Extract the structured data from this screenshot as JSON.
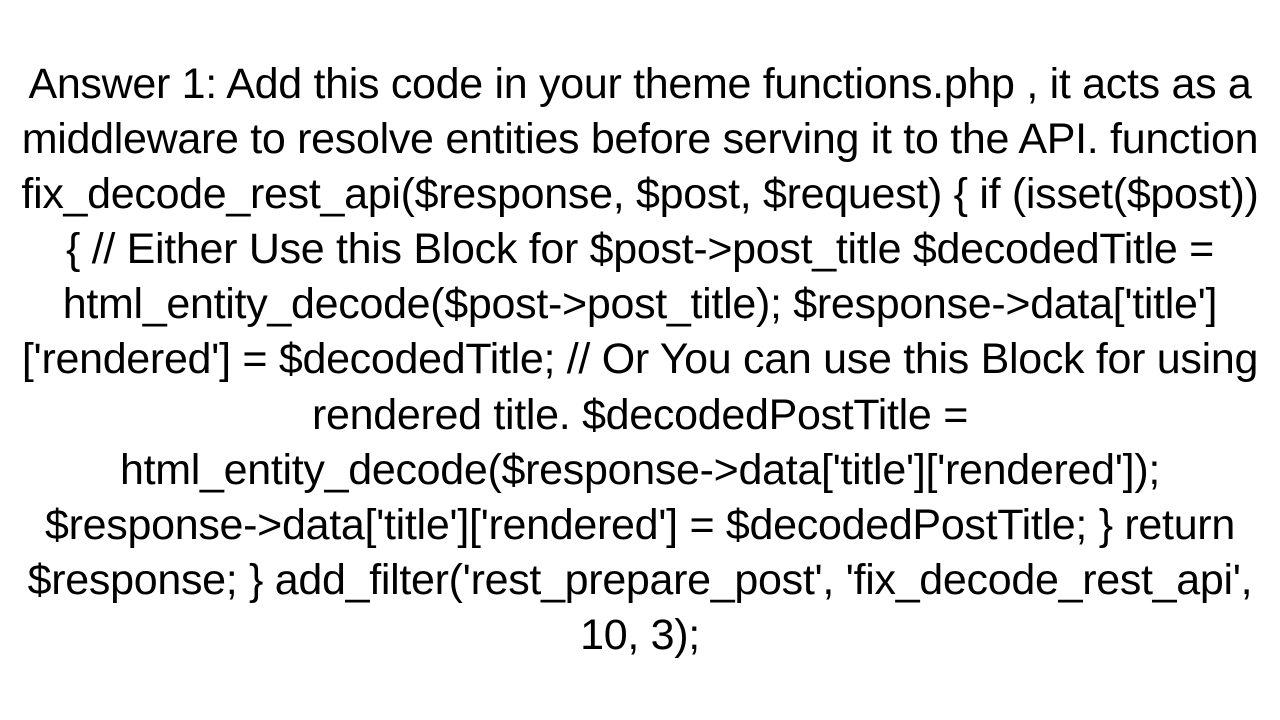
{
  "answer": {
    "text": "Answer 1: Add this code in your theme functions.php , it acts as a middleware to resolve entities before serving it to the API. function fix_decode_rest_api($response, $post, $request) {      if (isset($post)) {          // Either Use this Block for $post->post_title         $decodedTitle = html_entity_decode($post->post_title);         $response->data['title']['rendered'] = $decodedTitle;          // Or You can use this Block for using rendered title.         $decodedPostTitle = html_entity_decode($response->data['title']['rendered']);         $response->data['title']['rendered'] = $decodedPostTitle;      }     return $response; } add_filter('rest_prepare_post', 'fix_decode_rest_api', 10, 3);"
  }
}
